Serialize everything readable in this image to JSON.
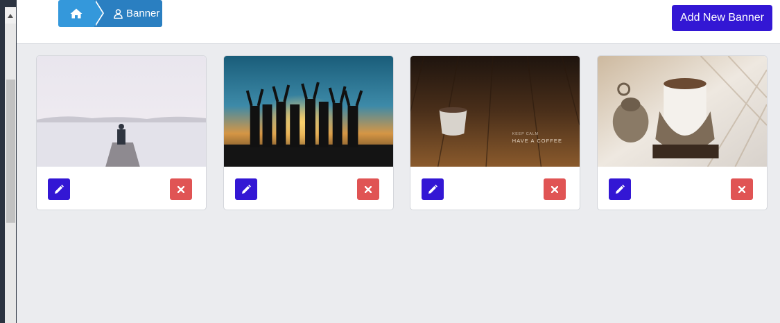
{
  "breadcrumb": {
    "home_icon": "home-icon",
    "current_icon": "user-icon",
    "current_label": "Banner"
  },
  "header": {
    "add_button_label": "Add New Banner"
  },
  "colors": {
    "primary": "#3317d4",
    "danger": "#e05454",
    "breadcrumb_home": "#3498db",
    "breadcrumb_current": "#2a7fc1",
    "page_background": "#ebecef"
  },
  "banners": [
    {
      "image": "person standing on pier over misty lake",
      "edit_icon": "pencil-icon",
      "delete_icon": "close-icon"
    },
    {
      "image": "group of people cheering at sunset",
      "edit_icon": "pencil-icon",
      "delete_icon": "close-icon"
    },
    {
      "image": "coffee cup on wooden table",
      "caption_line1": "KEEP CALM",
      "caption_line2": "HAVE A COFFEE",
      "edit_icon": "pencil-icon",
      "delete_icon": "close-icon"
    },
    {
      "image": "turkish coffee in ornate silver cup",
      "edit_icon": "pencil-icon",
      "delete_icon": "close-icon"
    }
  ]
}
